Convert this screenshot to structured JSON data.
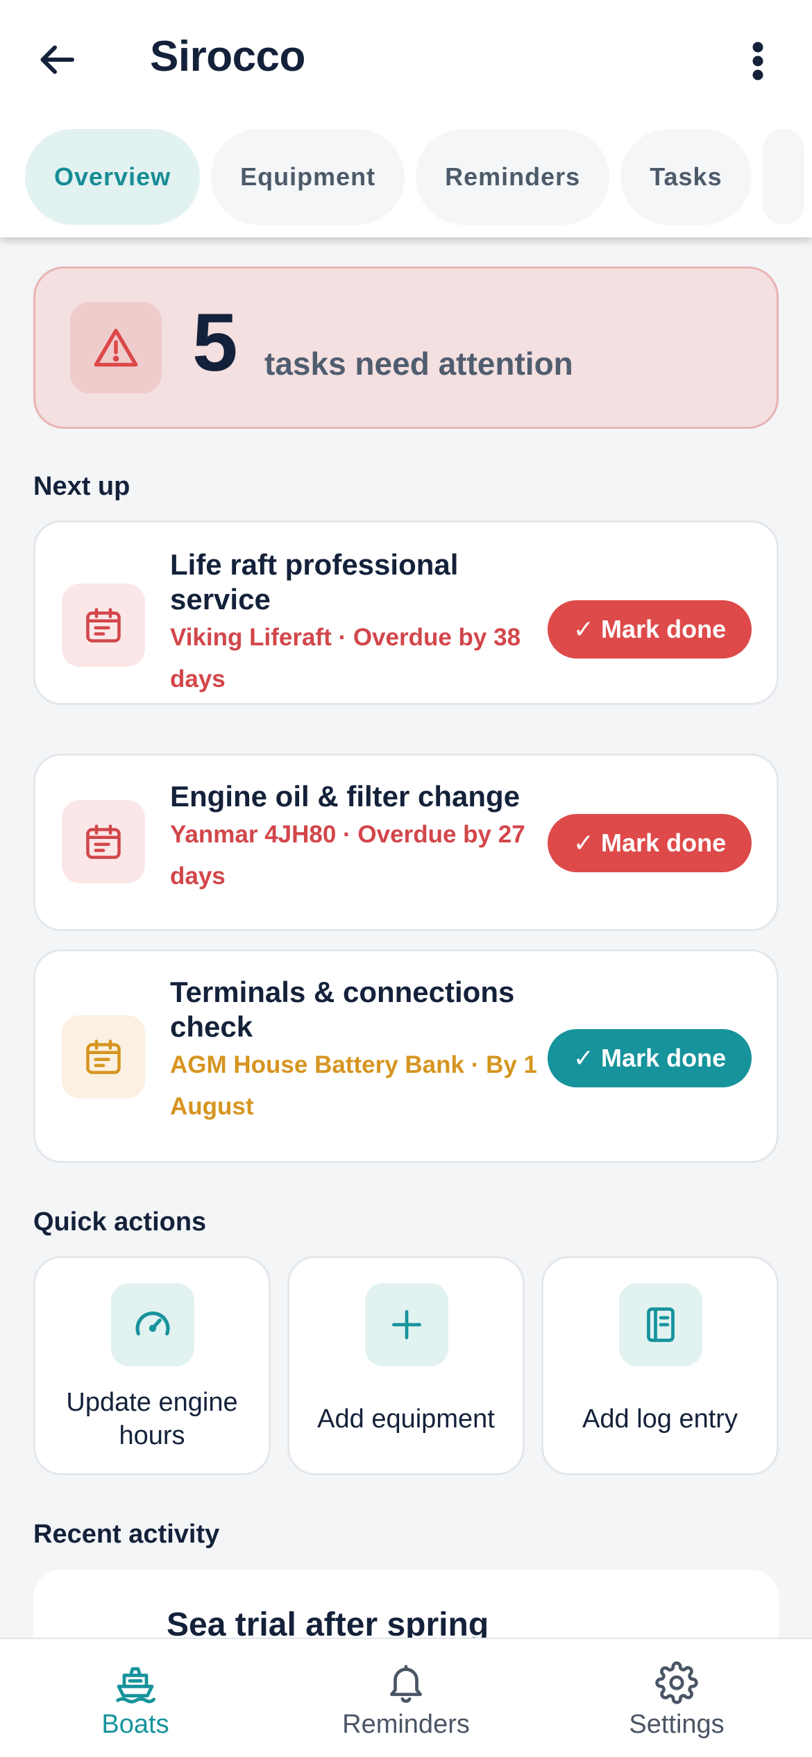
{
  "header": {
    "title": "Sirocco",
    "back_icon": "arrow-left-icon",
    "more_icon": "more-vertical-icon"
  },
  "tabs": [
    {
      "label": "Overview",
      "active": true
    },
    {
      "label": "Equipment",
      "active": false
    },
    {
      "label": "Reminders",
      "active": false
    },
    {
      "label": "Tasks",
      "active": false
    }
  ],
  "alert": {
    "count": "5",
    "text": "tasks need attention",
    "icon": "warning-triangle-icon"
  },
  "next_up": {
    "title": "Next up",
    "items": [
      {
        "title": "Life raft professional service",
        "subtitle": "Viking Liferaft · Overdue by 38 days",
        "button": "✓ Mark done",
        "status": "overdue"
      },
      {
        "title": "Engine oil & filter change",
        "subtitle": "Yanmar 4JH80 · Overdue by 27 days",
        "button": "✓ Mark done",
        "status": "overdue"
      },
      {
        "title": "Terminals & connections check",
        "subtitle": "AGM House Battery Bank · By 1 August",
        "button": "✓ Mark done",
        "status": "upcoming"
      }
    ]
  },
  "quick_actions": {
    "title": "Quick actions",
    "items": [
      {
        "label": "Update engine hours",
        "icon": "gauge-icon"
      },
      {
        "label": "Add equipment",
        "icon": "plus-icon"
      },
      {
        "label": "Add log entry",
        "icon": "notebook-icon"
      }
    ]
  },
  "recent_activity": {
    "title": "Recent activity",
    "first_item_title": "Sea trial after spring"
  },
  "bottom_nav": [
    {
      "label": "Boats",
      "icon": "boat-icon",
      "active": true
    },
    {
      "label": "Reminders",
      "icon": "bell-icon",
      "active": false
    },
    {
      "label": "Settings",
      "icon": "gear-icon",
      "active": false
    }
  ],
  "colors": {
    "accent": "#17939c",
    "danger": "#de4a4a",
    "warning": "#d69520",
    "text": "#14213a"
  }
}
